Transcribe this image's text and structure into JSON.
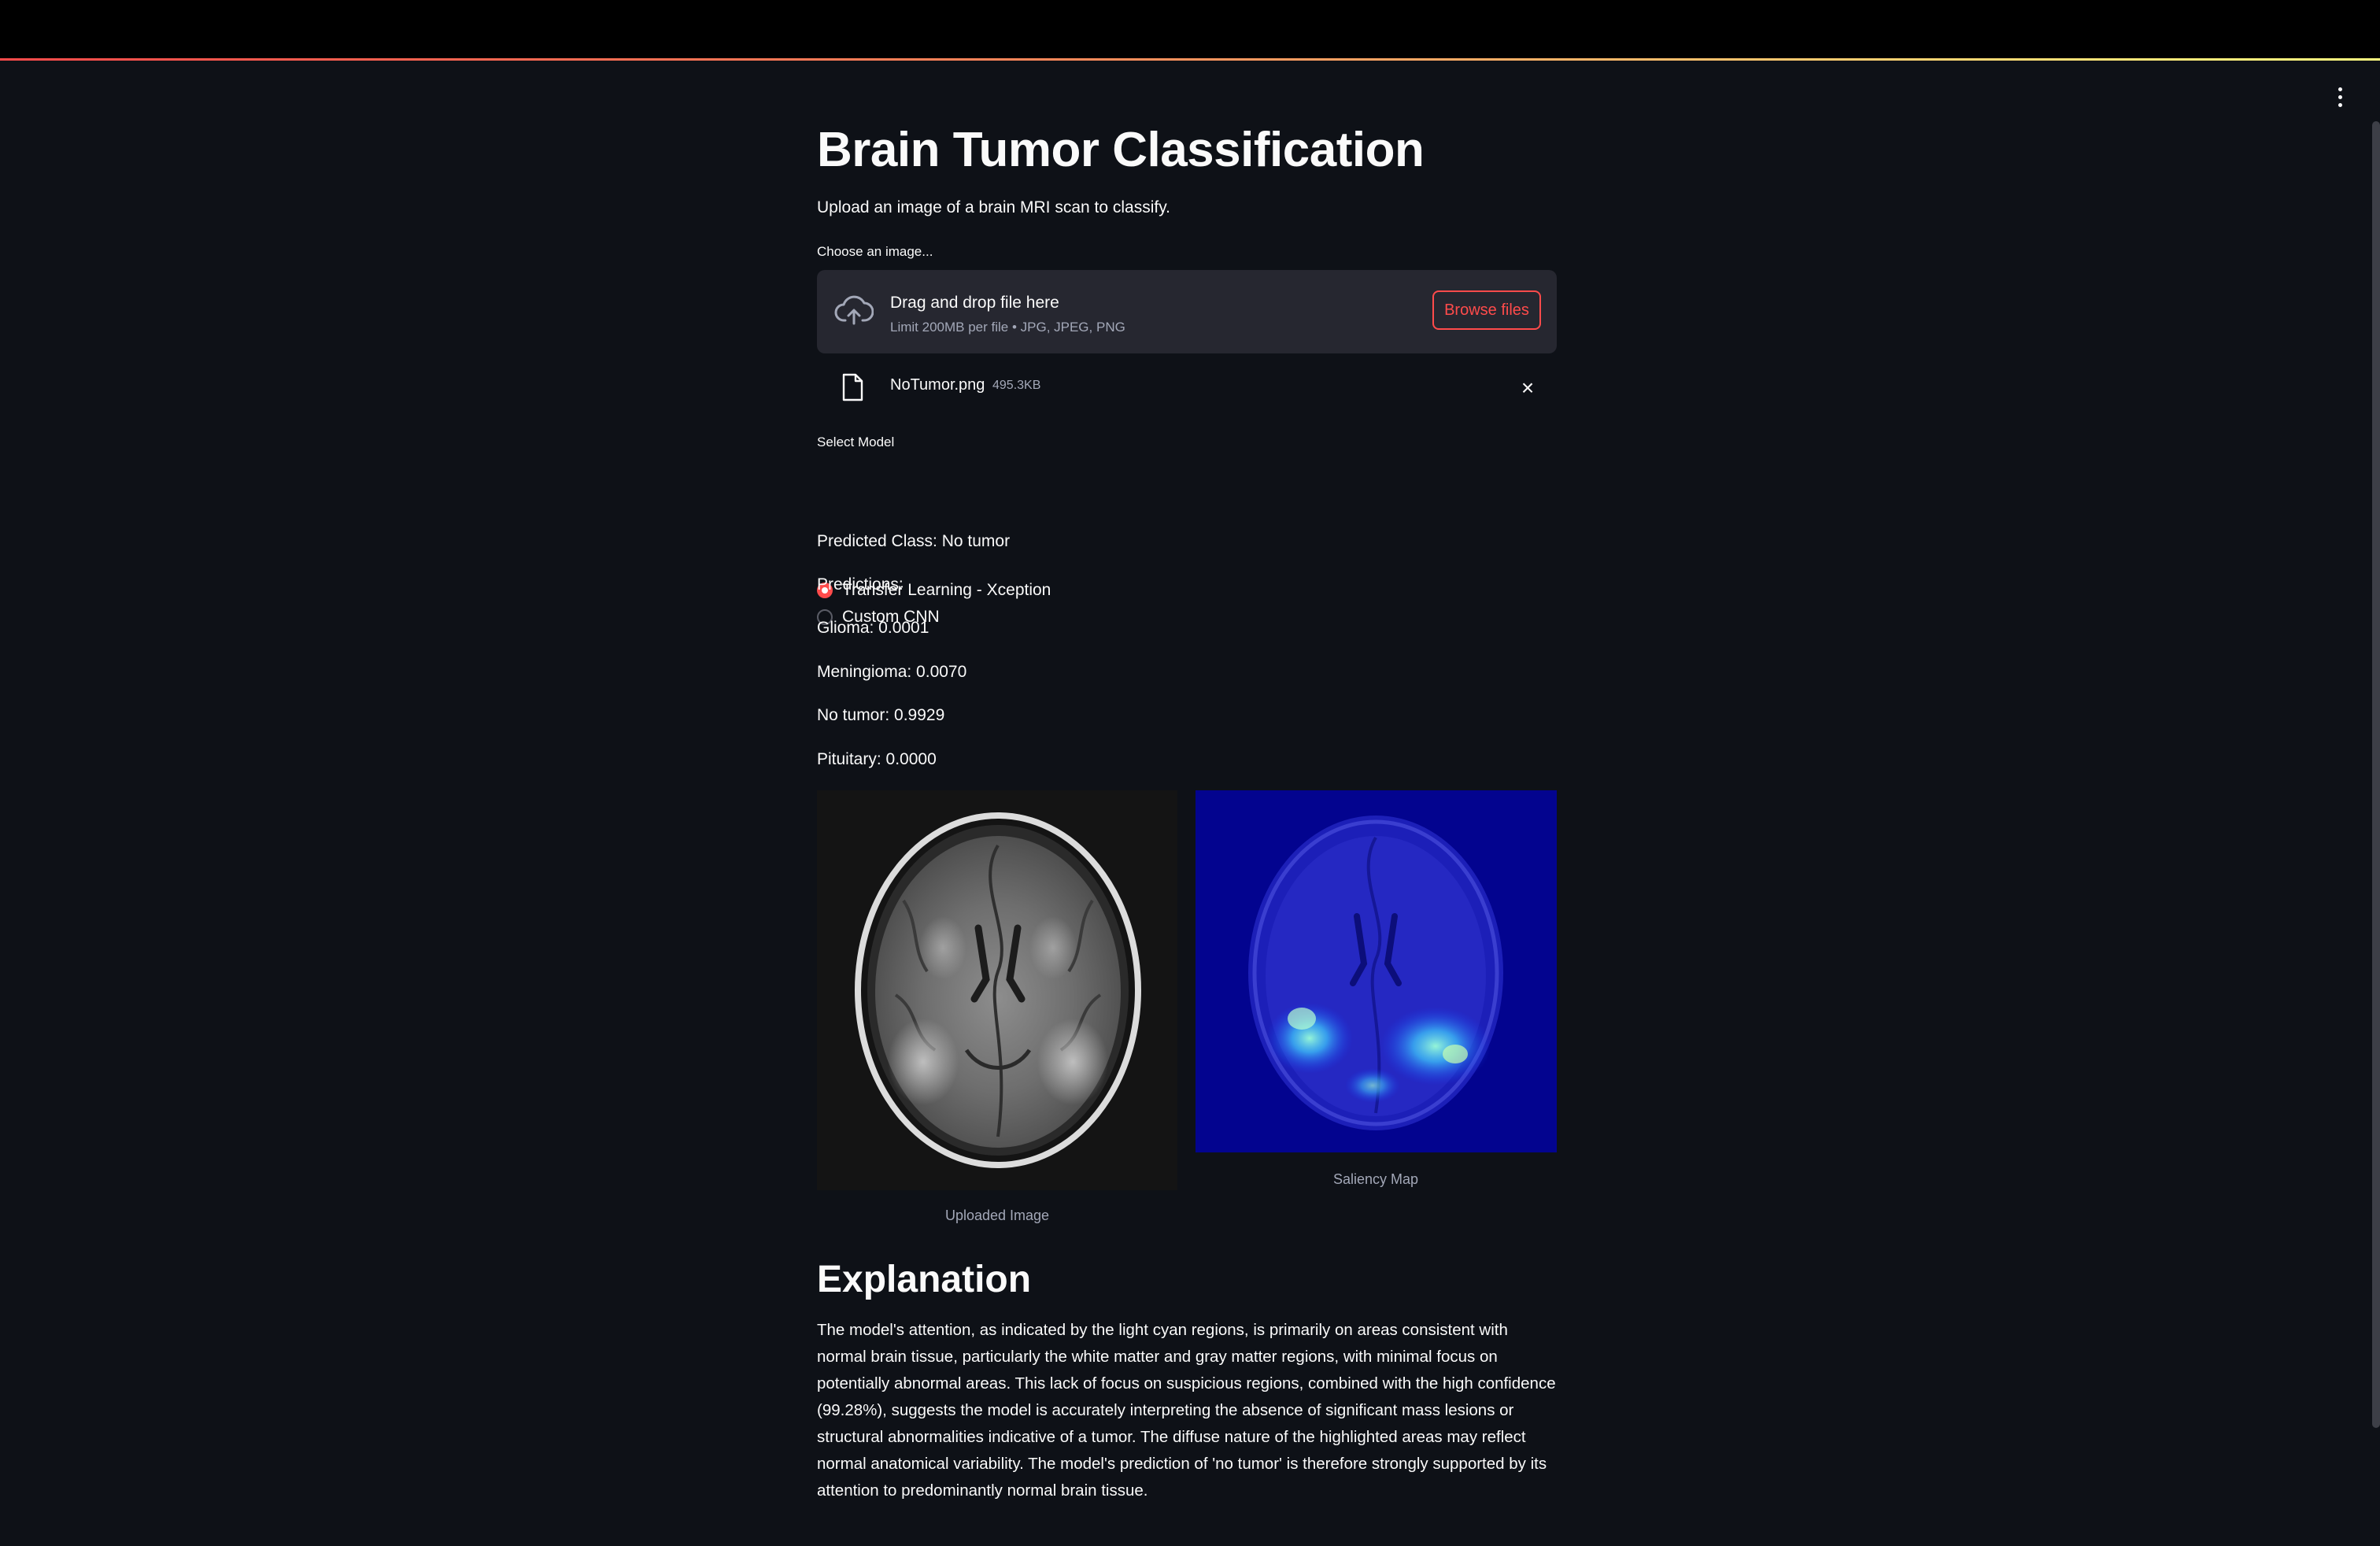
{
  "colors": {
    "accent": "#ff4b4b",
    "background": "#0e1117",
    "panel": "#262730",
    "muted": "#a3a8b8"
  },
  "header": {
    "menu_icon": "kebab-menu-icon"
  },
  "page": {
    "title": "Brain Tumor Classification",
    "subtitle": "Upload an image of a brain MRI scan to classify."
  },
  "uploader": {
    "label": "Choose an image...",
    "icon": "cloud-upload-icon",
    "drag_text": "Drag and drop file here",
    "limit_text": "Limit 200MB per file • JPG, JPEG, PNG",
    "browse_label": "Browse files",
    "file": {
      "name": "NoTumor.png",
      "size": "495.3KB",
      "icon": "file-icon",
      "remove_icon": "close-icon",
      "remove_glyph": "×"
    }
  },
  "model_select": {
    "label": "Select Model",
    "options": [
      {
        "label": "Transfer Learning - Xception",
        "selected": true
      },
      {
        "label": "Custom CNN",
        "selected": false
      }
    ]
  },
  "results": {
    "predicted_class": "Predicted Class: No tumor",
    "predictions_header": "Predictions:",
    "lines": [
      "Glioma: 0.0001",
      "Meningioma: 0.0070",
      "No tumor: 0.9929",
      "Pituitary: 0.0000"
    ]
  },
  "images": {
    "uploaded_caption": "Uploaded Image",
    "saliency_caption": "Saliency Map"
  },
  "explanation": {
    "heading": "Explanation",
    "text": "The model's attention, as indicated by the light cyan regions, is primarily on areas consistent with normal brain tissue, particularly the white matter and gray matter regions, with minimal focus on potentially abnormal areas. This lack of focus on suspicious regions, combined with the high confidence (99.28%), suggests the model is accurately interpreting the absence of significant mass lesions or structural abnormalities indicative of a tumor. The diffuse nature of the highlighted areas may reflect normal anatomical variability. The model's prediction of 'no tumor' is therefore strongly supported by its attention to predominantly normal brain tissue."
  }
}
